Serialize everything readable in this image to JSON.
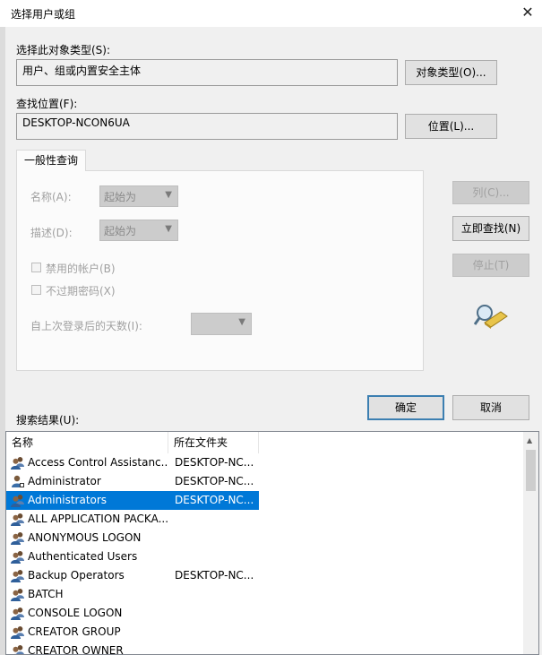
{
  "window": {
    "title": "选择用户或组",
    "close": "✕"
  },
  "object_type": {
    "label": "选择此对象类型(S):",
    "value": "用户、组或内置安全主体",
    "button": "对象类型(O)..."
  },
  "location": {
    "label": "查找位置(F):",
    "value": "DESKTOP-NCON6UA",
    "button": "位置(L)..."
  },
  "query": {
    "tab": "一般性查询",
    "name_label": "名称(A):",
    "name_combo": "起始为",
    "desc_label": "描述(D):",
    "desc_combo": "起始为",
    "disabled_accounts": "禁用的帐户(B)",
    "non_expiring": "不过期密码(X)",
    "days_label": "自上次登录后的天数(I):"
  },
  "side_buttons": {
    "columns": "列(C)...",
    "find_now": "立即查找(N)",
    "stop": "停止(T)"
  },
  "ok": "确定",
  "cancel": "取消",
  "results": {
    "label": "搜索结果(U):",
    "columns": [
      "名称",
      "所在文件夹"
    ],
    "rows": [
      {
        "name": "Access Control Assistanc...",
        "folder": "DESKTOP-NC...",
        "icon": "group-icon"
      },
      {
        "name": "Administrator",
        "folder": "DESKTOP-NC...",
        "icon": "user-icon"
      },
      {
        "name": "Administrators",
        "folder": "DESKTOP-NC...",
        "icon": "group-icon",
        "selected": true
      },
      {
        "name": "ALL APPLICATION PACKA...",
        "folder": "",
        "icon": "group-icon"
      },
      {
        "name": "ANONYMOUS LOGON",
        "folder": "",
        "icon": "group-icon"
      },
      {
        "name": "Authenticated Users",
        "folder": "",
        "icon": "group-icon"
      },
      {
        "name": "Backup Operators",
        "folder": "DESKTOP-NC...",
        "icon": "group-icon"
      },
      {
        "name": "BATCH",
        "folder": "",
        "icon": "group-icon"
      },
      {
        "name": "CONSOLE LOGON",
        "folder": "",
        "icon": "group-icon"
      },
      {
        "name": "CREATOR GROUP",
        "folder": "",
        "icon": "group-icon"
      },
      {
        "name": "CREATOR OWNER",
        "folder": "",
        "icon": "group-icon"
      }
    ]
  },
  "colors": {
    "selection": "#0078d7",
    "default_button_border": "#3c7fb1"
  }
}
